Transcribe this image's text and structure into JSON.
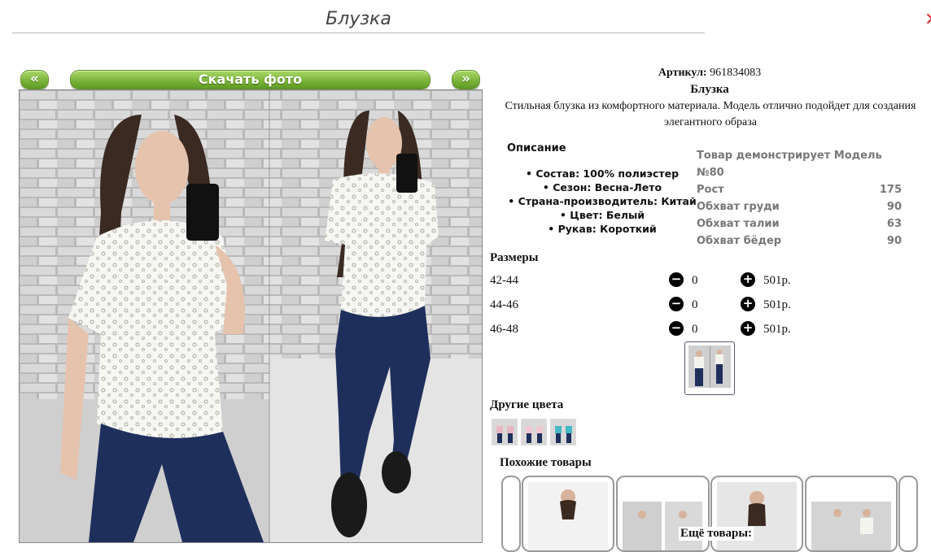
{
  "page": {
    "title": "Блузка",
    "close_symbol": "✕"
  },
  "gallery": {
    "prev_label": "«",
    "next_label": "»",
    "download_label": "Скачать фото"
  },
  "product": {
    "article_label": "Артикул:",
    "article_value": "961834083",
    "name": "Блузка",
    "description": "Стильная блузка из комфортного материала. Модель отлично подойдет для создания элегантного образа"
  },
  "details": {
    "title": "Описание",
    "items": [
      "Состав: 100% полиэстер",
      "Сезон: Весна-Лето",
      "Страна-производитель: Китай",
      "Цвет: Белый",
      "Рукав: Короткий"
    ]
  },
  "model": {
    "header": "Товар демонстрирует Модель №80",
    "rows": [
      {
        "label": "Рост",
        "value": "175"
      },
      {
        "label": "Обхват груди",
        "value": "90"
      },
      {
        "label": "Обхват талии",
        "value": "63"
      },
      {
        "label": "Обхват бёдер",
        "value": "90"
      }
    ]
  },
  "sizes": {
    "title": "Размеры",
    "minus_symbol": "−",
    "plus_symbol": "+",
    "rows": [
      {
        "size": "42-44",
        "qty": "0",
        "price": "501р."
      },
      {
        "size": "44-46",
        "qty": "0",
        "price": "501р."
      },
      {
        "size": "46-48",
        "qty": "0",
        "price": "501р."
      }
    ]
  },
  "other_colors": {
    "title": "Другие цвета"
  },
  "similar": {
    "title": "Похожие товары",
    "more_label": "Ещё товары:"
  },
  "colors": {
    "accent_green": "#7db43c",
    "model_text": "#777777"
  }
}
